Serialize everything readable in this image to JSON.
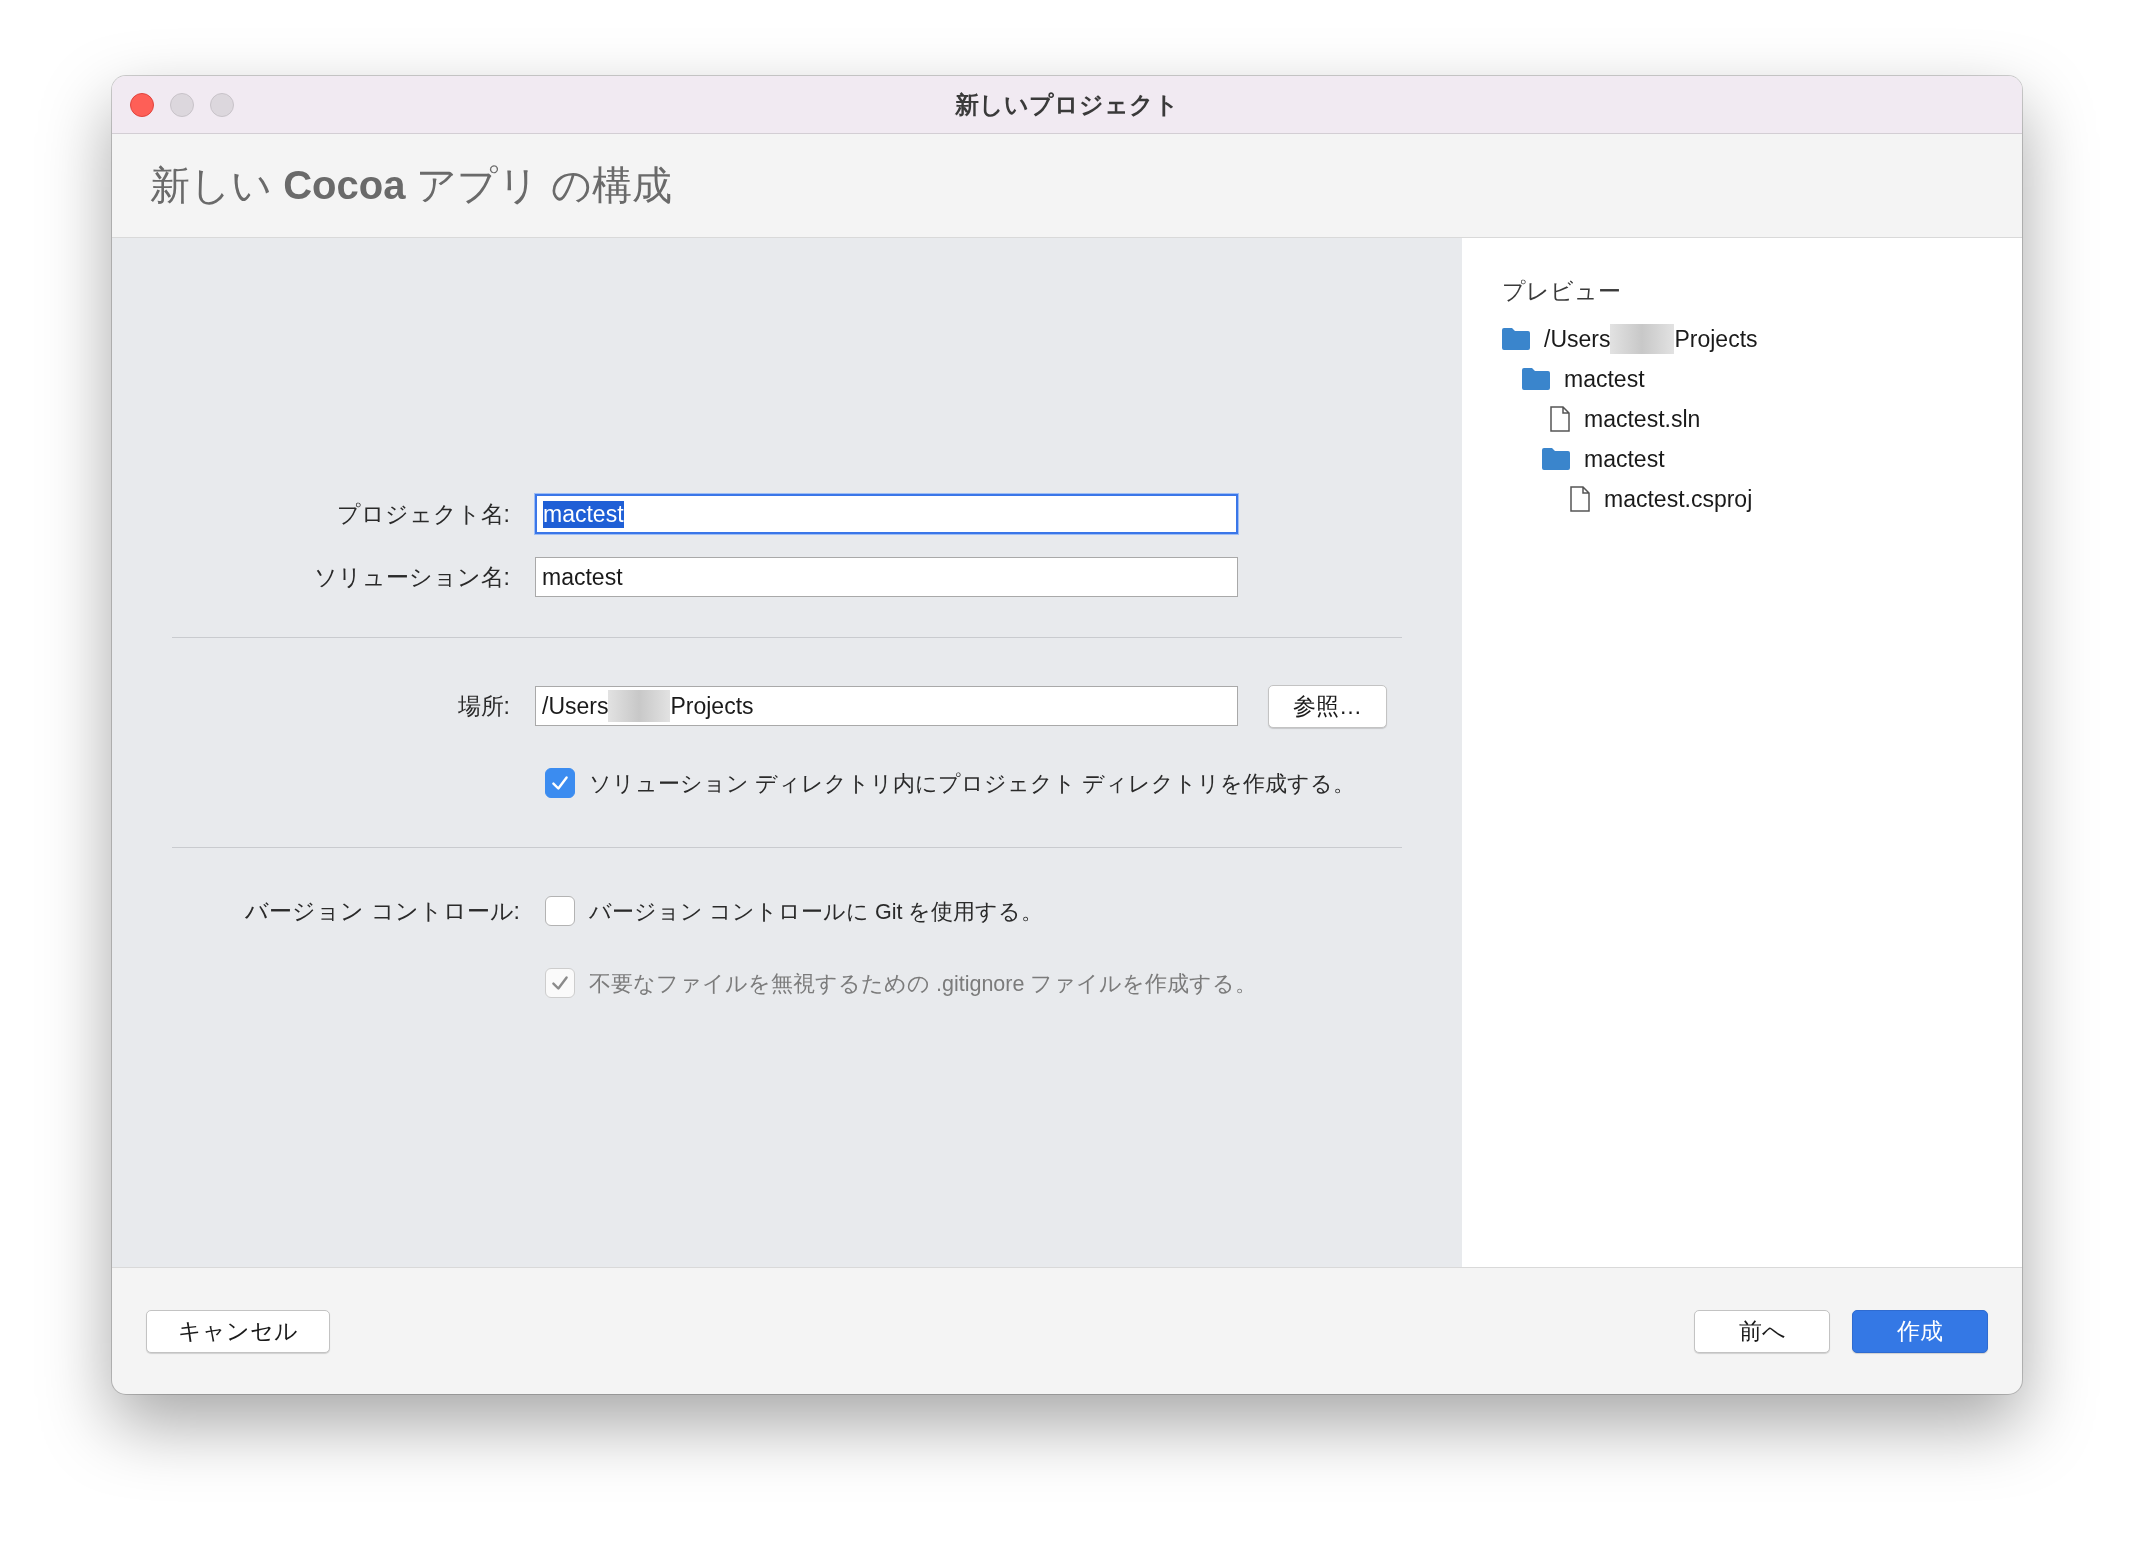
{
  "window": {
    "title": "新しいプロジェクト"
  },
  "heading": "新しい **Cocoa** アプリ の構成",
  "form": {
    "fields": [
      {
        "label": "プロジェクト名:",
        "value": "mactest",
        "focused": true,
        "text_selected": true
      },
      {
        "label": "ソリューション名:",
        "value": "mactest",
        "focused": false,
        "text_selected": false
      }
    ],
    "location": {
      "label": "場所:",
      "value_start": "/Users",
      "value_end": "Projects",
      "browse_button": "参照…"
    },
    "create_directory": {
      "label": "ソリューション ディレクトリ内にプロジェクト ディレクトリを作成する。",
      "checked": true,
      "disabled": false
    },
    "version_control": {
      "label": "バージョン コントロール:",
      "options": [
        {
          "label": "バージョン コントロールに Git を使用する。",
          "checked": false,
          "disabled": false
        },
        {
          "label": "不要なファイルを無視するための .gitignore ファイルを作成する。",
          "checked": true,
          "disabled": true
        }
      ]
    }
  },
  "preview": {
    "title": "プレビュー",
    "tree": [
      {
        "kind": "folder",
        "name": "/Users",
        "name_end": "Projects",
        "children": [
          {
            "kind": "folder",
            "name": "mactest",
            "children": [
              {
                "kind": "file",
                "name": "mactest.sln"
              },
              {
                "kind": "folder",
                "name": "mactest",
                "children": [
                  {
                    "kind": "file",
                    "name": "mactest.csproj"
                  }
                ]
              }
            ]
          }
        ]
      }
    ]
  },
  "footer": {
    "left_buttons": [
      {
        "label": "キャンセル",
        "kind": "default"
      }
    ],
    "right_buttons": [
      {
        "label": "前へ",
        "kind": "default"
      },
      {
        "label": "作成",
        "kind": "primary"
      }
    ]
  }
}
